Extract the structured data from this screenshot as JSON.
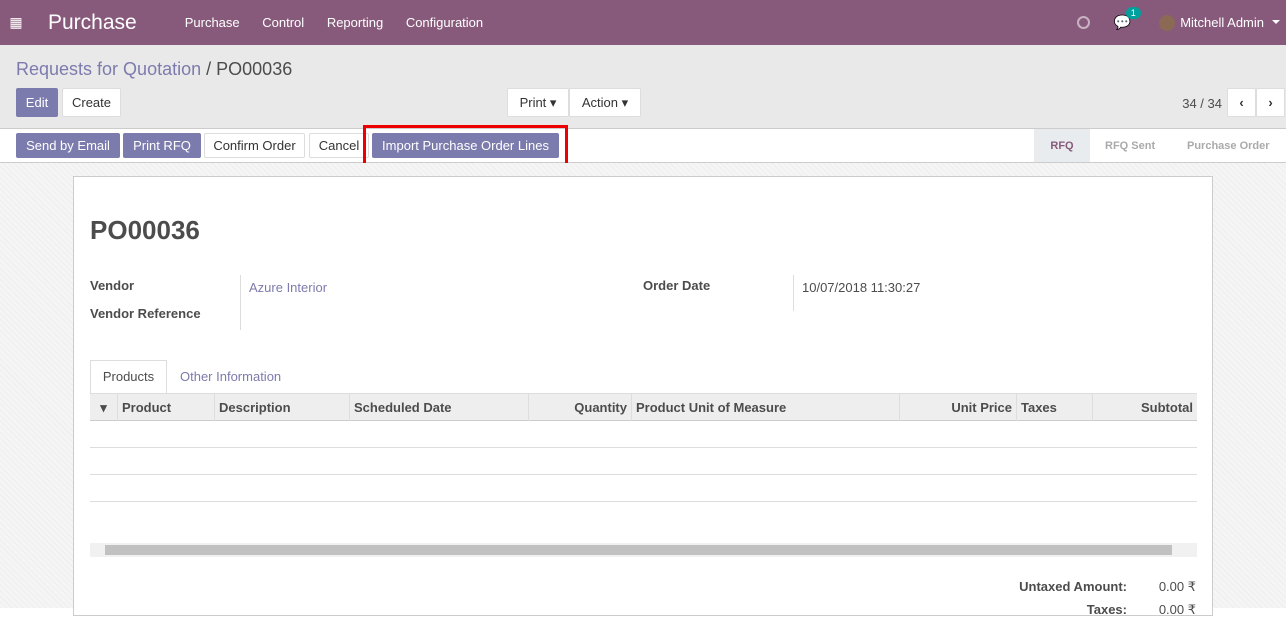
{
  "nav": {
    "brand": "Purchase",
    "menu": [
      "Purchase",
      "Control",
      "Reporting",
      "Configuration"
    ],
    "chat_count": "1",
    "user": "Mitchell Admin"
  },
  "breadcrumb": {
    "parent": "Requests for Quotation",
    "sep": "/",
    "current": "PO00036"
  },
  "buttons": {
    "edit": "Edit",
    "create": "Create",
    "print": "Print",
    "action": "Action",
    "send_email": "Send by Email",
    "print_rfq": "Print RFQ",
    "confirm": "Confirm Order",
    "cancel": "Cancel",
    "import": "Import Purchase Order Lines"
  },
  "pager": {
    "text": "34 / 34"
  },
  "status": [
    "RFQ",
    "RFQ Sent",
    "Purchase Order"
  ],
  "form": {
    "title": "PO00036",
    "vendor_label": "Vendor",
    "vendor": "Azure Interior",
    "vendor_ref_label": "Vendor Reference",
    "order_date_label": "Order Date",
    "order_date": "10/07/2018 11:30:27",
    "tabs": [
      "Products",
      "Other Information"
    ],
    "columns": [
      "Product",
      "Description",
      "Scheduled Date",
      "Quantity",
      "Product Unit of Measure",
      "Unit Price",
      "Taxes",
      "Subtotal"
    ],
    "untaxed_label": "Untaxed Amount:",
    "untaxed": "0.00 ₹",
    "taxes_label": "Taxes:",
    "taxes": "0.00 ₹"
  }
}
